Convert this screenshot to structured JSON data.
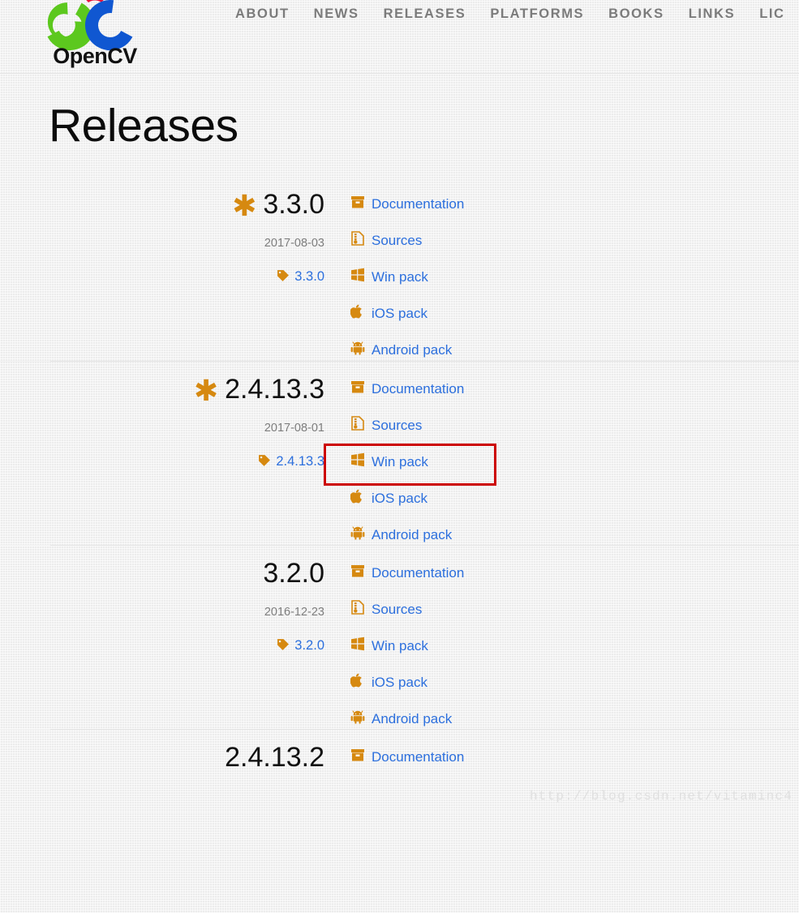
{
  "header": {
    "logo": {
      "name": "opencv-logo",
      "wordmark": "OpenCV",
      "colors": {
        "green": "#5cc81e",
        "red": "#e8123b",
        "blue": "#1057d1",
        "text": "#111111"
      }
    },
    "nav": [
      {
        "label": "ABOUT",
        "name": "nav-about"
      },
      {
        "label": "NEWS",
        "name": "nav-news"
      },
      {
        "label": "RELEASES",
        "name": "nav-releases"
      },
      {
        "label": "PLATFORMS",
        "name": "nav-platforms"
      },
      {
        "label": "BOOKS",
        "name": "nav-books"
      },
      {
        "label": "LINKS",
        "name": "nav-links"
      },
      {
        "label": "LIC",
        "name": "nav-license"
      }
    ]
  },
  "page": {
    "title": "Releases"
  },
  "theme": {
    "link_blue": "#2c6fdd",
    "icon_orange": "#d68910",
    "nav_gray": "#7b7b7b",
    "date_gray": "#7d7d7d",
    "annotation_red": "#cc0000"
  },
  "releases": [
    {
      "version": "3.3.0",
      "starred": true,
      "star_glyph": "✱",
      "date": "2017-08-03",
      "tag_label": "3.3.0",
      "links": [
        {
          "label": "Documentation",
          "icon": "archive-icon"
        },
        {
          "label": "Sources",
          "icon": "file-archive-icon"
        },
        {
          "label": "Win pack",
          "icon": "windows-icon"
        },
        {
          "label": "iOS pack",
          "icon": "apple-icon"
        },
        {
          "label": "Android pack",
          "icon": "android-icon"
        }
      ]
    },
    {
      "version": "2.4.13.3",
      "starred": true,
      "star_glyph": "✱",
      "date": "2017-08-01",
      "tag_label": "2.4.13.3",
      "links": [
        {
          "label": "Documentation",
          "icon": "archive-icon"
        },
        {
          "label": "Sources",
          "icon": "file-archive-icon"
        },
        {
          "label": "Win pack",
          "icon": "windows-icon"
        },
        {
          "label": "iOS pack",
          "icon": "apple-icon"
        },
        {
          "label": "Android pack",
          "icon": "android-icon"
        }
      ]
    },
    {
      "version": "3.2.0",
      "starred": false,
      "star_glyph": "",
      "date": "2016-12-23",
      "tag_label": "3.2.0",
      "links": [
        {
          "label": "Documentation",
          "icon": "archive-icon"
        },
        {
          "label": "Sources",
          "icon": "file-archive-icon"
        },
        {
          "label": "Win pack",
          "icon": "windows-icon"
        },
        {
          "label": "iOS pack",
          "icon": "apple-icon"
        },
        {
          "label": "Android pack",
          "icon": "android-icon"
        }
      ]
    },
    {
      "version": "2.4.13.2",
      "starred": false,
      "star_glyph": "",
      "date": "",
      "tag_label": "",
      "links": [
        {
          "label": "Documentation",
          "icon": "archive-icon"
        }
      ]
    }
  ],
  "annotation": {
    "type": "red-rectangle-highlight",
    "target": "Win pack",
    "target_release": "2.4.13.3"
  },
  "watermark": {
    "text": "http://blog.csdn.net/vitaminc4"
  }
}
